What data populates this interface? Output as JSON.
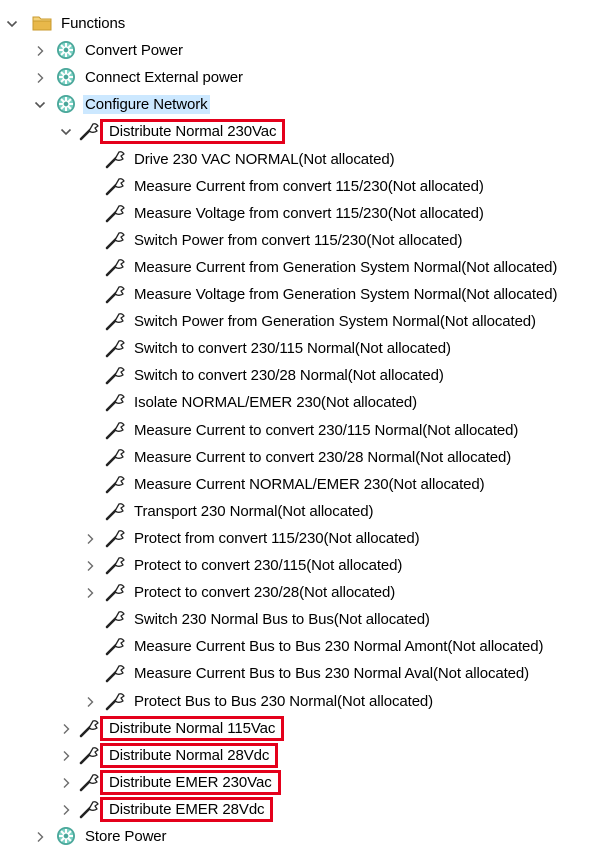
{
  "tree": {
    "root": {
      "label": "Functions",
      "icon": "folder-icon",
      "expanded": true
    },
    "level1": [
      {
        "label": "Convert Power",
        "icon": "function-gear-icon",
        "expanded": false
      },
      {
        "label": "Connect External power",
        "icon": "function-gear-icon",
        "expanded": false
      },
      {
        "label": "Configure Network",
        "icon": "function-gear-icon",
        "expanded": true,
        "selected": true
      }
    ],
    "distribute_230": {
      "label": "Distribute Normal 230Vac",
      "icon": "wrench-icon",
      "expanded": true,
      "highlighted": true
    },
    "children_230": [
      {
        "label": "Drive 230 VAC NORMAL(Not allocated)",
        "has_children": false
      },
      {
        "label": "Measure Current from convert 115/230(Not allocated)",
        "has_children": false
      },
      {
        "label": "Measure Voltage from convert 115/230(Not allocated)",
        "has_children": false
      },
      {
        "label": "Switch Power from convert 115/230(Not allocated)",
        "has_children": false
      },
      {
        "label": "Measure Current from Generation System Normal(Not allocated)",
        "has_children": false
      },
      {
        "label": "Measure Voltage from Generation System Normal(Not allocated)",
        "has_children": false
      },
      {
        "label": "Switch Power from Generation System Normal(Not allocated)",
        "has_children": false
      },
      {
        "label": "Switch to convert 230/115 Normal(Not allocated)",
        "has_children": false
      },
      {
        "label": "Switch to convert 230/28 Normal(Not allocated)",
        "has_children": false
      },
      {
        "label": "Isolate NORMAL/EMER 230(Not allocated)",
        "has_children": false
      },
      {
        "label": "Measure Current to convert 230/115 Normal(Not allocated)",
        "has_children": false
      },
      {
        "label": "Measure Current to convert 230/28 Normal(Not allocated)",
        "has_children": false
      },
      {
        "label": "Measure Current NORMAL/EMER 230(Not allocated)",
        "has_children": false
      },
      {
        "label": "Transport 230 Normal(Not allocated)",
        "has_children": false
      },
      {
        "label": "Protect from convert 115/230(Not allocated)",
        "has_children": true
      },
      {
        "label": "Protect to convert 230/115(Not allocated)",
        "has_children": true
      },
      {
        "label": "Protect to convert 230/28(Not allocated)",
        "has_children": true
      },
      {
        "label": "Switch 230 Normal Bus to Bus(Not allocated)",
        "has_children": false
      },
      {
        "label": "Measure Current Bus to Bus 230 Normal Amont(Not allocated)",
        "has_children": false
      },
      {
        "label": "Measure Current Bus to Bus 230 Normal Aval(Not allocated)",
        "has_children": false
      },
      {
        "label": "Protect Bus to Bus 230 Normal(Not allocated)",
        "has_children": true
      }
    ],
    "distribute_others": [
      {
        "label": "Distribute Normal 115Vac",
        "highlighted": true,
        "expanded": false
      },
      {
        "label": "Distribute Normal 28Vdc",
        "highlighted": true,
        "expanded": false
      },
      {
        "label": "Distribute EMER 230Vac",
        "highlighted": true,
        "expanded": false
      },
      {
        "label": "Distribute EMER 28Vdc",
        "highlighted": true,
        "expanded": false
      }
    ],
    "trailing": [
      {
        "label": "Store Power",
        "icon": "function-gear-icon",
        "expanded": false
      }
    ]
  },
  "colors": {
    "selection": "#cce8ff",
    "highlight_box": "#e4001b",
    "chevron": "#6b6b6b",
    "gear_icon": "#4aa79a",
    "folder": "#e8b84a"
  }
}
